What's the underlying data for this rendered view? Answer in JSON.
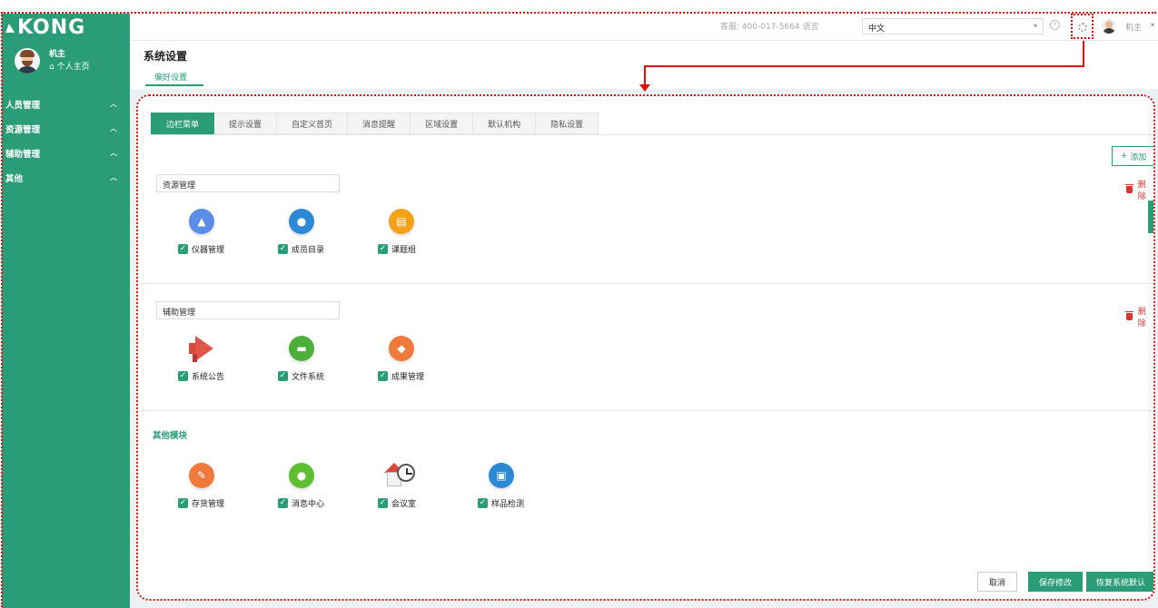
{
  "brand": {
    "logo_text": "KONG"
  },
  "user": {
    "name": "机主",
    "home_link": "个人主页"
  },
  "sidebar": {
    "items": [
      {
        "label": "人员管理"
      },
      {
        "label": "资源管理"
      },
      {
        "label": "辅助管理"
      },
      {
        "label": "其他"
      }
    ]
  },
  "topbar": {
    "hotline": "客服: 400-017-5664 语言",
    "language_value": "中文",
    "user_name": "机主"
  },
  "page": {
    "title": "系统设置",
    "subtab": "偏好设置"
  },
  "tabs": [
    {
      "label": "边栏菜单",
      "active": true
    },
    {
      "label": "提示设置"
    },
    {
      "label": "自定义首页"
    },
    {
      "label": "消息提醒"
    },
    {
      "label": "区域设置"
    },
    {
      "label": "默认机构"
    },
    {
      "label": "隐私设置"
    }
  ],
  "actions": {
    "add_label": "添加",
    "delete_label": "删除",
    "cancel_label": "取消",
    "save_label": "保存修改",
    "restore_label": "恢复系统默认"
  },
  "groups": [
    {
      "name": "资源管理",
      "modules": [
        {
          "label": "仪器管理",
          "icon": "instrument-icon",
          "color": "#5a8ee6"
        },
        {
          "label": "成员目录",
          "icon": "member-icon",
          "color": "#2b89d6"
        },
        {
          "label": "课题组",
          "icon": "book-icon",
          "color": "#f5a21a"
        }
      ]
    },
    {
      "name": "辅助管理",
      "modules": [
        {
          "label": "系统公告",
          "icon": "megaphone-icon"
        },
        {
          "label": "文件系统",
          "icon": "folder-icon",
          "color": "#4caf3a"
        },
        {
          "label": "成果管理",
          "icon": "diamond-icon",
          "color": "#ef7a3c"
        }
      ]
    }
  ],
  "other": {
    "title": "其他模块",
    "modules": [
      {
        "label": "存货管理",
        "icon": "inventory-icon",
        "color": "#ef7a3c"
      },
      {
        "label": "消息中心",
        "icon": "message-icon",
        "color": "#5bbf2e"
      },
      {
        "label": "会议室",
        "icon": "meeting-room-icon"
      },
      {
        "label": "样品检测",
        "icon": "sample-icon",
        "color": "#2b89d6"
      }
    ]
  }
}
